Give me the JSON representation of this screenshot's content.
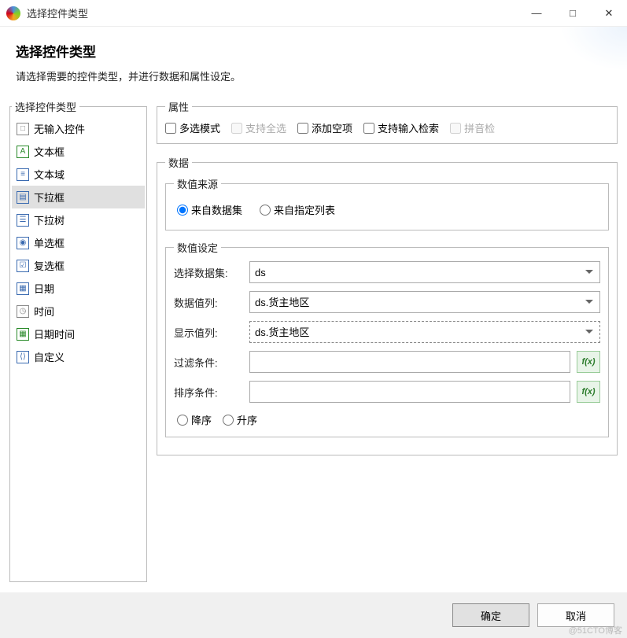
{
  "window": {
    "title": "选择控件类型",
    "minimize": "—",
    "maximize": "□",
    "close": "✕"
  },
  "header": {
    "title": "选择控件类型",
    "subtitle": "请选择需要的控件类型，并进行数据和属性设定。"
  },
  "left": {
    "legend": "选择控件类型",
    "items": [
      {
        "label": "无输入控件",
        "icon_color": "#888",
        "icon_glyph": "□"
      },
      {
        "label": "文本框",
        "icon_color": "#2a8a2a",
        "icon_glyph": "A"
      },
      {
        "label": "文本域",
        "icon_color": "#3a6ab0",
        "icon_glyph": "≡"
      },
      {
        "label": "下拉框",
        "icon_color": "#3a6ab0",
        "icon_glyph": "▤"
      },
      {
        "label": "下拉树",
        "icon_color": "#3a6ab0",
        "icon_glyph": "☰"
      },
      {
        "label": "单选框",
        "icon_color": "#3a6ab0",
        "icon_glyph": "◉"
      },
      {
        "label": "复选框",
        "icon_color": "#3a6ab0",
        "icon_glyph": "☑"
      },
      {
        "label": "日期",
        "icon_color": "#3a6ab0",
        "icon_glyph": "▦"
      },
      {
        "label": "时间",
        "icon_color": "#888",
        "icon_glyph": "◷"
      },
      {
        "label": "日期时间",
        "icon_color": "#2a8a2a",
        "icon_glyph": "▦"
      },
      {
        "label": "自定义",
        "icon_color": "#3a6ab0",
        "icon_glyph": "⟨⟩"
      }
    ],
    "selected_index": 3
  },
  "props": {
    "legend": "属性",
    "options": [
      {
        "label": "多选模式",
        "checked": false,
        "disabled": false
      },
      {
        "label": "支持全选",
        "checked": false,
        "disabled": true
      },
      {
        "label": "添加空项",
        "checked": false,
        "disabled": false
      },
      {
        "label": "支持输入检索",
        "checked": false,
        "disabled": false
      },
      {
        "label": "拼音检",
        "checked": false,
        "disabled": true
      }
    ]
  },
  "data_section": {
    "legend": "数据",
    "source": {
      "legend": "数值来源",
      "options": [
        {
          "label": "来自数据集",
          "checked": true
        },
        {
          "label": "来自指定列表",
          "checked": false
        }
      ]
    },
    "settings": {
      "legend": "数值设定",
      "dataset_label": "选择数据集:",
      "dataset_value": "ds",
      "data_col_label": "数据值列:",
      "data_col_value": "ds.货主地区",
      "display_col_label": "显示值列:",
      "display_col_value": "ds.货主地区",
      "filter_label": "过滤条件:",
      "filter_value": "",
      "sort_label": "排序条件:",
      "sort_value": "",
      "fx": "f(x)",
      "order": [
        {
          "label": "降序",
          "checked": false
        },
        {
          "label": "升序",
          "checked": false
        }
      ]
    }
  },
  "footer": {
    "ok": "确定",
    "cancel": "取消"
  },
  "watermark": "@51CTO博客"
}
